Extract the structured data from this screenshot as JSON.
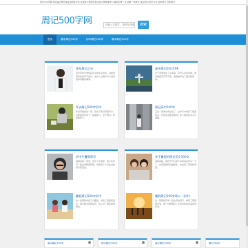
{
  "topbar": {
    "text": "周记500字网 周记是记录日常生活的好方法 这里有大量周记范文供大家参考学习 每周记录一点 积累一份成长 欢迎访问 周记大全 初中周记 高中周记"
  },
  "header": {
    "logo": "周记500字网",
    "search_placeholder": "请输入关键字，按回车搜索",
    "search_button": "搜索"
  },
  "nav": {
    "items": [
      "首页",
      "高中周记500字",
      "初中周记500字",
      "高中周记500字"
    ]
  },
  "panels": {
    "left_top": [
      {
        "title": "青年周记之光",
        "excerpt": "周记写作记录的是生活的点点滴滴，最能体现你的思考与成长，在这个过程中可以发现很多有趣的事情。"
      },
      {
        "title": "军训周记500字初中",
        "excerpt": "军训开始的第一周，阳光下我们挥洒汗水，在教官的带领下一遍遍练习，终于明白了坚持的意义。"
      }
    ],
    "right_top": [
      {
        "title": "高中周记500字PK",
        "excerpt": "这一周里发生了许多事，有开心也有烦恼，我试着把它们写下来，慢慢地学会了面对和思考。"
      },
      {
        "title": "周记高中500字",
        "excerpt": "又是一周的时间过去了，在学习中收获了很多知识，也在生活里感受到了家人朋友的关心与温暖。"
      }
    ],
    "left_bottom": [
      {
        "title": "初中生暑假周记",
        "excerpt": "暑假的第一周里，我去了外婆家，和小伙伴们一起在田野里奔跑，感受到了乡村生活的快乐和自由。"
      },
      {
        "title": "暑假周记500字初中",
        "excerpt": "这个暑假我参加了兴趣班，学会了画画和游泳，每天都过得很充实，也认识了很多新的朋友。"
      }
    ],
    "right_bottom": [
      {
        "title": "关于暑假的周记范文500字",
        "excerpt": "暑假来临，我终于可以放下书包好好休息一下了，在家里帮妈妈做家务，体会到了劳动的辛苦。"
      },
      {
        "title": "暑假周记500字高二（初中）",
        "excerpt": "这一周我和同学一起去海边旅行，看到了美丽的日落，那一刻我明白了生活中处处有美好的风景。"
      }
    ]
  },
  "bottom_panels": [
    "高中周记500字",
    "初中周记500字",
    "高中周记500字",
    "周记500字"
  ],
  "colors": {
    "accent": "#1e8fd7",
    "title": "#2b6fb8",
    "logo": "#1c8fd0"
  }
}
